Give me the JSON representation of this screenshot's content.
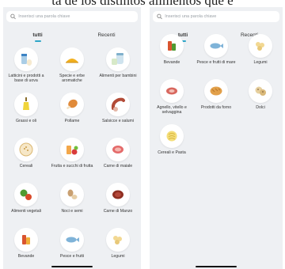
{
  "caption": "ta de los distintos alimentos que e",
  "left": {
    "search_placeholder": "Inserisci una parola chiave",
    "tabs": [
      {
        "label": "tutti"
      },
      {
        "label": "Recenti"
      }
    ],
    "categories": [
      {
        "label": "Latticini e prodotti a base di uova",
        "icon": "milk-eggs-icon"
      },
      {
        "label": "Specie e erbe aromatiche",
        "icon": "spices-icon"
      },
      {
        "label": "Alimenti per bambini",
        "icon": "baby-food-icon"
      },
      {
        "label": "Grassi e oli",
        "icon": "oil-bottle-icon"
      },
      {
        "label": "Pollame",
        "icon": "chicken-leg-icon"
      },
      {
        "label": "Salsicce e salumi",
        "icon": "sausage-icon"
      },
      {
        "label": "Cereali",
        "icon": "cereal-bowl-icon"
      },
      {
        "label": "Frutta e succhi di frutta",
        "icon": "fruit-juice-icon"
      },
      {
        "label": "Carne di maiale",
        "icon": "pork-icon"
      },
      {
        "label": "Alimenti vegetali",
        "icon": "vegetables-icon"
      },
      {
        "label": "Noci e semi",
        "icon": "nuts-icon"
      },
      {
        "label": "Carne di Manzo",
        "icon": "beef-icon"
      },
      {
        "label": "Bevande",
        "icon": "drinks-icon"
      },
      {
        "label": "Pesce e frutti",
        "icon": "fish-icon"
      },
      {
        "label": "Legumi",
        "icon": "legumes-icon"
      }
    ]
  },
  "right": {
    "search_placeholder": "Inserisci una parola chiave",
    "tabs": [
      {
        "label": "tutti"
      },
      {
        "label": "Recenti"
      }
    ],
    "categories": [
      {
        "label": "Bevande",
        "icon": "drinks-icon"
      },
      {
        "label": "Pesce e frutti di mare",
        "icon": "fish-icon"
      },
      {
        "label": "Legumi",
        "icon": "legumes-icon"
      },
      {
        "label": "Agnello, vitello e selvaggina",
        "icon": "lamb-meat-icon"
      },
      {
        "label": "Prodotti da forno",
        "icon": "bread-icon"
      },
      {
        "label": "Dolci",
        "icon": "cookies-icon"
      },
      {
        "label": "Cereali e Pasta",
        "icon": "pasta-icon"
      }
    ]
  },
  "colors": {
    "panel_bg": "#eef0f3",
    "accent": "#2ea6c8"
  }
}
